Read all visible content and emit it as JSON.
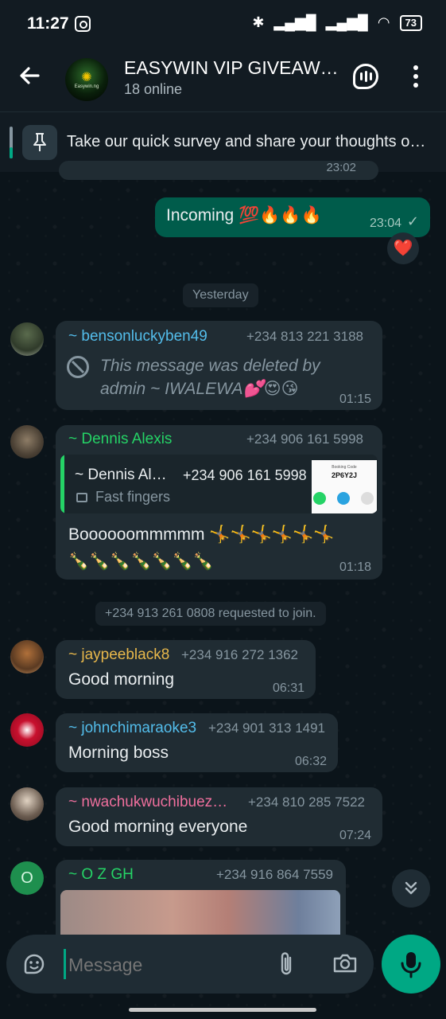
{
  "status_bar": {
    "time": "11:27",
    "battery": "73"
  },
  "header": {
    "title": "EASYWIN VIP GIVEAW…",
    "subtitle": "18 online",
    "avatar_text": "Easywin.ng"
  },
  "pinned": {
    "text": "Take our quick survey and share your thoughts o…"
  },
  "partial_time": "23:02",
  "out_message": {
    "text": "Incoming 💯🔥🔥🔥",
    "time": "23:04",
    "reaction": "❤️"
  },
  "date_divider": "Yesterday",
  "messages": [
    {
      "sender": "~ bensonluckyben49",
      "phone": "+234 813 221 3188",
      "deleted_text": "This message was deleted by admin ~ IWALEWA💕😍😘",
      "time": "01:15",
      "sender_color": "#53bdeb"
    },
    {
      "sender": "~ Dennis Alexis",
      "phone": "+234 906 161 5998",
      "reply": {
        "sender": "~ Dennis Al…",
        "phone": "+234 906 161 5998",
        "label": "Fast fingers",
        "thumb_title": "Booking Code",
        "thumb_code": "2P6Y2J"
      },
      "text": "Boooooommmmm 🤸🤸🤸🤸🤸🤸🍾🍾🍾🍾🍾🍾🍾",
      "time": "01:18",
      "sender_color": "#25d366"
    },
    {
      "sender": "~ jaypeeblack8",
      "phone": "+234 916 272 1362",
      "text": "Good morning",
      "time": "06:31",
      "sender_color": "#e8b84b"
    },
    {
      "sender": "~ johnchimaraoke3",
      "phone": "+234 901 313 1491",
      "text": "Morning boss",
      "time": "06:32",
      "sender_color": "#53bdeb"
    },
    {
      "sender": "~ nwachukwuchibuez…",
      "phone": "+234 810 285 7522",
      "text": "Good morning everyone",
      "time": "07:24",
      "sender_color": "#ef6f9d"
    },
    {
      "sender": "~ O Z GH",
      "phone": "+234 916 864 7559",
      "avatar_letter": "O",
      "sender_color": "#25d366"
    }
  ],
  "system_join": "+234 913 261 0808 requested to join.",
  "input": {
    "placeholder": "Message"
  },
  "colors": {
    "accent": "#00a884",
    "outgoing": "#005c4b",
    "incoming": "#202c33",
    "background": "#0b141a"
  }
}
